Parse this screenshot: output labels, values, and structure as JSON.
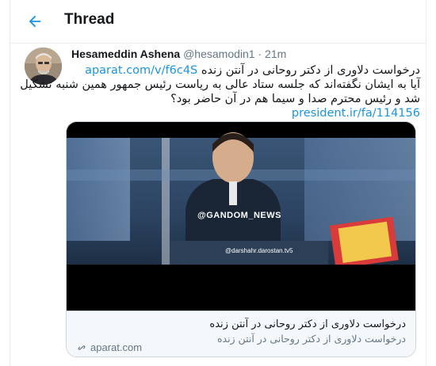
{
  "header": {
    "title": "Thread"
  },
  "tweet": {
    "author_name": "Hesameddin Ashena",
    "author_handle": "@hesamodin1",
    "separator": "·",
    "time": "21m",
    "text_line1": "درخواست دلاوری از دکتر روحانی در آنتن زنده",
    "link1": "aparat.com/v/f6c4S",
    "text_line2": "آیا به ایشان نگفته‌اند که جلسه ستاد عالی به ریاست رئیس جمهور همین شنبه تشکیل",
    "text_line3": "شد و رئیس محترم صدا و سیما هم در آن حاضر بود؟",
    "link2": "president.ir/fa/114156"
  },
  "card": {
    "watermark_top": "@GANDOM_NEWS",
    "watermark_bottom": "@darshahr.darostan.tv5",
    "title": "درخواست دلاوری از دکتر روحانی در آنتن زنده",
    "description": "درخواست دلاوری از دکتر روحانی در آنتن زنده",
    "domain": "aparat.com"
  },
  "colors": {
    "accent": "#1b95e0",
    "secondary_text": "#657786",
    "border": "#e6ecf0"
  },
  "icons": {
    "back": "arrow-left-icon",
    "link": "link-icon"
  }
}
